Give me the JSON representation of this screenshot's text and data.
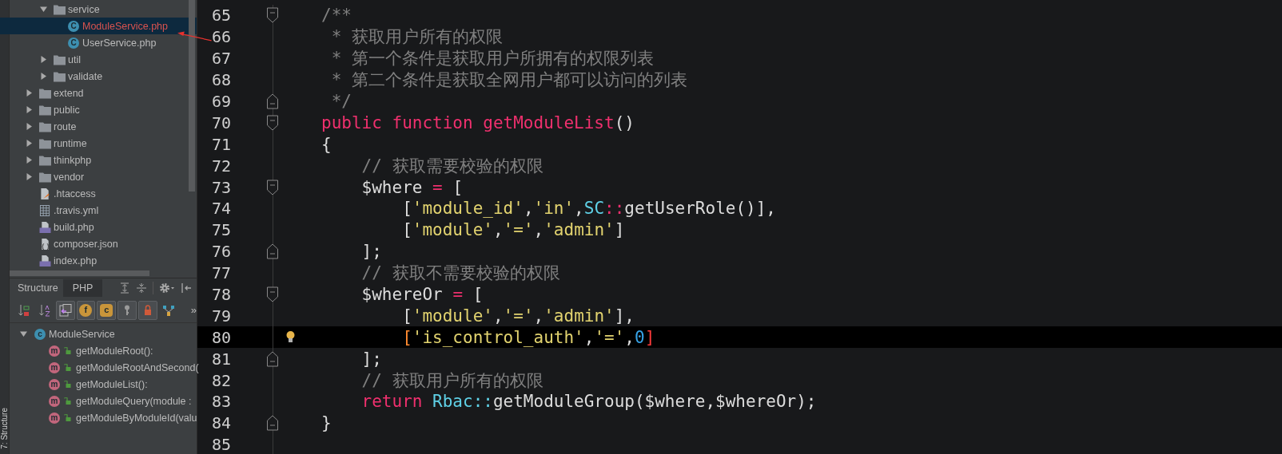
{
  "left_strip": {
    "label": "7: Structure"
  },
  "project_tree": {
    "items": [
      {
        "children": [
          {
            "label": "service",
            "kind": "folder",
            "expanded": true,
            "selected": false,
            "children": [
              {
                "label": "ModuleService.php",
                "kind": "class",
                "badge": "C",
                "selected": true,
                "color": "#d9534f"
              },
              {
                "label": "UserService.php",
                "kind": "class",
                "badge": "C",
                "selected": false
              }
            ]
          },
          {
            "label": "util",
            "kind": "folder",
            "expanded": false,
            "selected": false
          },
          {
            "label": "validate",
            "kind": "folder",
            "expanded": false,
            "selected": false
          }
        ]
      },
      {
        "label": "extend",
        "kind": "folder",
        "expanded": false,
        "selected": false
      },
      {
        "label": "public",
        "kind": "folder",
        "expanded": false,
        "selected": false
      },
      {
        "label": "route",
        "kind": "folder",
        "expanded": false,
        "selected": false
      },
      {
        "label": "runtime",
        "kind": "folder",
        "expanded": false,
        "selected": false
      },
      {
        "label": "thinkphp",
        "kind": "folder",
        "expanded": false,
        "selected": false
      },
      {
        "label": "vendor",
        "kind": "folder",
        "expanded": false,
        "selected": false
      },
      {
        "label": ".htaccess",
        "kind": "htaccess",
        "selected": false
      },
      {
        "label": ".travis.yml",
        "kind": "yml",
        "selected": false
      },
      {
        "label": "build.php",
        "kind": "php",
        "selected": false
      },
      {
        "label": "composer.json",
        "kind": "json",
        "selected": false
      },
      {
        "label": "index.php",
        "kind": "php",
        "selected": false
      }
    ]
  },
  "structure_panel": {
    "tabs": [
      {
        "label": "Structure",
        "selected": false
      },
      {
        "label": "PHP",
        "selected": true
      }
    ],
    "header_actions": [
      {
        "kind": "expand-all"
      },
      {
        "kind": "collapse-all"
      },
      {
        "kind": "gear"
      },
      {
        "kind": "pin-left"
      }
    ],
    "toolbar": [
      {
        "kind": "sort-visibility"
      },
      {
        "kind": "sort-alpha"
      },
      {
        "kind": "inherited",
        "on": true
      },
      {
        "kind": "fields",
        "badge": "f",
        "on": true
      },
      {
        "kind": "constants",
        "badge": "c",
        "on": true
      },
      {
        "kind": "keys",
        "on": true
      },
      {
        "kind": "private",
        "on": true
      },
      {
        "kind": "hierarchy"
      },
      {
        "kind": "more",
        "label": "»"
      }
    ],
    "tree": [
      {
        "label": "ModuleService",
        "badge": "c",
        "expanded": true,
        "selected": false,
        "children": [
          {
            "label": "getModuleRoot():",
            "badge": "m",
            "selected": false
          },
          {
            "label": "getModuleRootAndSecond(",
            "badge": "m",
            "selected": false
          },
          {
            "label": "getModuleList():",
            "badge": "m",
            "selected": false
          },
          {
            "label": "getModuleQuery(module :",
            "badge": "m",
            "selected": false
          },
          {
            "label": "getModuleByModuleId(valu",
            "badge": "m",
            "selected": false
          }
        ]
      }
    ]
  },
  "editor": {
    "lines": [
      {
        "number": "65",
        "kind": "fold-start",
        "current": false,
        "intention": false,
        "tokens": [
          {
            "kind": "comment",
            "text": "/**"
          }
        ]
      },
      {
        "number": "66",
        "kind": "plain",
        "current": false,
        "intention": false,
        "tokens": [
          {
            "kind": "comment",
            "text": " * 获取用户所有的权限"
          }
        ]
      },
      {
        "number": "67",
        "kind": "plain",
        "current": false,
        "intention": false,
        "tokens": [
          {
            "kind": "comment",
            "text": " * 第一个条件是获取用户所拥有的权限列表"
          }
        ]
      },
      {
        "number": "68",
        "kind": "plain",
        "current": false,
        "intention": false,
        "tokens": [
          {
            "kind": "comment",
            "text": " * 第二个条件是获取全网用户都可以访问的列表"
          }
        ]
      },
      {
        "number": "69",
        "kind": "fold-end",
        "current": false,
        "intention": false,
        "tokens": [
          {
            "kind": "comment",
            "text": " */"
          }
        ]
      },
      {
        "number": "70",
        "kind": "fold-start",
        "current": false,
        "intention": false,
        "tokens": [
          {
            "kind": "keyword",
            "text": "public function getModuleList"
          },
          {
            "kind": "plain",
            "text": "()"
          }
        ]
      },
      {
        "number": "71",
        "kind": "plain",
        "current": false,
        "intention": false,
        "tokens": [
          {
            "kind": "plain",
            "text": "{"
          }
        ]
      },
      {
        "number": "72",
        "kind": "plain",
        "current": false,
        "intention": false,
        "tokens": [
          {
            "kind": "comment",
            "text": "    // 获取需要校验的权限"
          }
        ]
      },
      {
        "number": "73",
        "kind": "fold-start",
        "current": false,
        "intention": false,
        "tokens": [
          {
            "kind": "plain",
            "text": "    $where "
          },
          {
            "kind": "operator",
            "text": "="
          },
          {
            "kind": "plain",
            "text": " ["
          }
        ]
      },
      {
        "number": "74",
        "kind": "plain",
        "current": false,
        "intention": false,
        "tokens": [
          {
            "kind": "plain",
            "text": "        ["
          },
          {
            "kind": "string",
            "text": "'module_id'"
          },
          {
            "kind": "plain",
            "text": ","
          },
          {
            "kind": "string",
            "text": "'in'"
          },
          {
            "kind": "plain",
            "text": ","
          },
          {
            "kind": "class",
            "text": "SC"
          },
          {
            "kind": "operator",
            "text": "::"
          },
          {
            "kind": "plain",
            "text": "getUserRole()],"
          }
        ]
      },
      {
        "number": "75",
        "kind": "plain",
        "current": false,
        "intention": false,
        "tokens": [
          {
            "kind": "plain",
            "text": "        ["
          },
          {
            "kind": "string",
            "text": "'module'"
          },
          {
            "kind": "plain",
            "text": ","
          },
          {
            "kind": "string",
            "text": "'='"
          },
          {
            "kind": "plain",
            "text": ","
          },
          {
            "kind": "string",
            "text": "'admin'"
          },
          {
            "kind": "plain",
            "text": "]"
          }
        ]
      },
      {
        "number": "76",
        "kind": "fold-end",
        "current": false,
        "intention": false,
        "tokens": [
          {
            "kind": "plain",
            "text": "    ];"
          }
        ]
      },
      {
        "number": "77",
        "kind": "plain",
        "current": false,
        "intention": false,
        "tokens": [
          {
            "kind": "comment",
            "text": "    // 获取不需要校验的权限"
          }
        ]
      },
      {
        "number": "78",
        "kind": "fold-start",
        "current": false,
        "intention": false,
        "tokens": [
          {
            "kind": "plain",
            "text": "    $whereOr "
          },
          {
            "kind": "operator",
            "text": "="
          },
          {
            "kind": "plain",
            "text": " ["
          }
        ]
      },
      {
        "number": "79",
        "kind": "plain",
        "current": false,
        "intention": false,
        "tokens": [
          {
            "kind": "plain",
            "text": "        ["
          },
          {
            "kind": "string",
            "text": "'module'"
          },
          {
            "kind": "plain",
            "text": ","
          },
          {
            "kind": "string",
            "text": "'='"
          },
          {
            "kind": "plain",
            "text": ","
          },
          {
            "kind": "string",
            "text": "'admin'"
          },
          {
            "kind": "plain",
            "text": "],"
          }
        ]
      },
      {
        "number": "80",
        "kind": "plain",
        "current": true,
        "intention": true,
        "tokens": [
          {
            "kind": "brace-open",
            "text": "        ["
          },
          {
            "kind": "string",
            "text": "'is_control_auth'"
          },
          {
            "kind": "plain",
            "text": ","
          },
          {
            "kind": "string",
            "text": "'='"
          },
          {
            "kind": "plain",
            "text": ","
          },
          {
            "kind": "number",
            "text": "0"
          },
          {
            "kind": "brace-close",
            "text": "]"
          }
        ]
      },
      {
        "number": "81",
        "kind": "fold-end",
        "current": false,
        "intention": false,
        "tokens": [
          {
            "kind": "plain",
            "text": "    ];"
          }
        ]
      },
      {
        "number": "82",
        "kind": "plain",
        "current": false,
        "intention": false,
        "tokens": [
          {
            "kind": "comment",
            "text": "    // 获取用户所有的权限"
          }
        ]
      },
      {
        "number": "83",
        "kind": "plain",
        "current": false,
        "intention": false,
        "tokens": [
          {
            "kind": "keyword",
            "text": "    return "
          },
          {
            "kind": "class",
            "text": "Rbac::"
          },
          {
            "kind": "plain",
            "text": "getModuleGroup($where,$whereOr);"
          }
        ]
      },
      {
        "number": "84",
        "kind": "fold-end",
        "current": false,
        "intention": false,
        "tokens": [
          {
            "kind": "plain",
            "text": "}"
          }
        ]
      },
      {
        "number": "85",
        "kind": "plain",
        "current": false,
        "intention": false
      }
    ]
  }
}
